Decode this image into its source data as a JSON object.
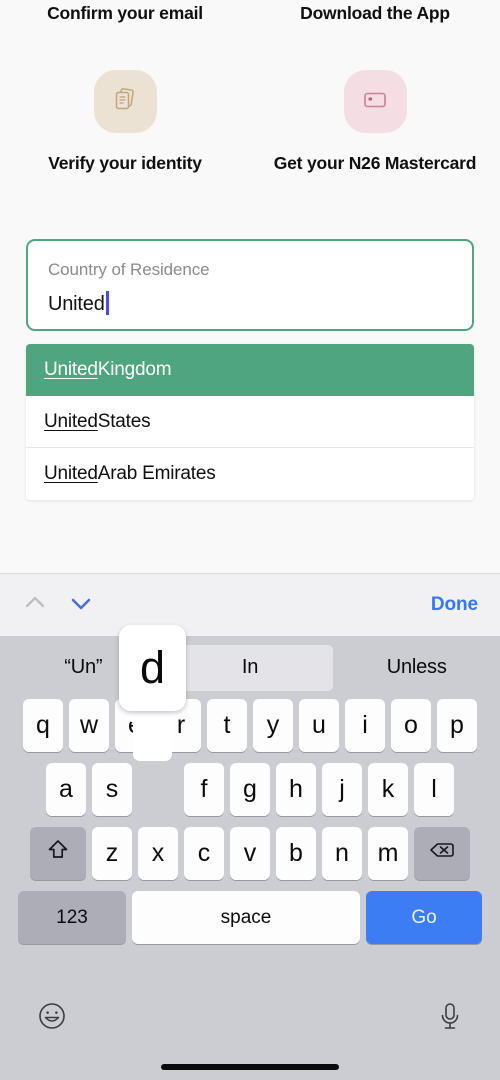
{
  "onboarding": {
    "steps": [
      {
        "title": "Confirm your email",
        "icon": "documents-icon",
        "icon_bg": "#ece2d4",
        "label": "Verify your identity"
      },
      {
        "title": "Download the App",
        "icon": "bank-card-icon",
        "icon_bg": "#f5dde4",
        "label": "Get your N26 Mastercard"
      }
    ]
  },
  "country_field": {
    "name": "country-of-residence",
    "label": "Country of Residence",
    "value": "United",
    "placeholder": "Country of Residence",
    "focused": true,
    "border_color": "#4fa67e",
    "caret_color": "#4b4be6"
  },
  "suggestions": {
    "selected_index": 0,
    "highlight_color": "#4fa67e",
    "match_text": "United",
    "items": [
      {
        "match": "United",
        "rest": " Kingdom",
        "full": "United Kingdom",
        "selected": true
      },
      {
        "match": "United",
        "rest": " States",
        "full": "United States",
        "selected": false
      },
      {
        "match": "United",
        "rest": " Arab Emirates",
        "full": "United Arab Emirates",
        "selected": false
      }
    ]
  },
  "keyboard_toolbar": {
    "prev_enabled": false,
    "next_enabled": true,
    "prev_icon": "chevron-up-icon",
    "next_icon": "chevron-down-icon",
    "done_label": "Done",
    "done_color": "#3478f6"
  },
  "predictions": {
    "items": [
      {
        "label": "“Un”",
        "highlighted": false
      },
      {
        "label": "In",
        "highlighted": true
      },
      {
        "label": "Unless",
        "highlighted": false
      }
    ]
  },
  "keyboard": {
    "pressed_key": "d",
    "rows": {
      "row1": [
        "q",
        "w",
        "e",
        "r",
        "t",
        "y",
        "u",
        "i",
        "o",
        "p"
      ],
      "row2": [
        "a",
        "s",
        "d",
        "f",
        "g",
        "h",
        "j",
        "k",
        "l"
      ],
      "row3": [
        "z",
        "x",
        "c",
        "v",
        "b",
        "n",
        "m"
      ]
    },
    "shift_icon": "shift-icon",
    "backspace_icon": "backspace-icon",
    "numbers_label": "123",
    "space_label": "space",
    "return_label": "Go",
    "return_color": "#3d7df4",
    "emoji_icon": "emoji-smiley-icon",
    "dictation_icon": "microphone-icon"
  }
}
